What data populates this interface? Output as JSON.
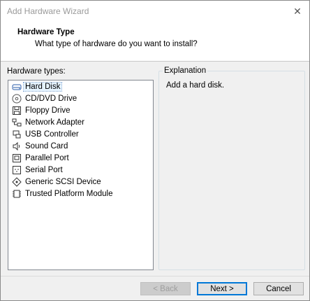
{
  "window": {
    "title": "Add Hardware Wizard",
    "close_glyph": "✕"
  },
  "header": {
    "title": "Hardware Type",
    "subtitle": "What type of hardware do you want to install?"
  },
  "hardware_list": {
    "label": "Hardware types:",
    "selected": "Hard Disk",
    "items": [
      {
        "label": "Hard Disk",
        "icon": "hard-disk-icon"
      },
      {
        "label": "CD/DVD Drive",
        "icon": "cd-dvd-icon"
      },
      {
        "label": "Floppy Drive",
        "icon": "floppy-icon"
      },
      {
        "label": "Network Adapter",
        "icon": "network-adapter-icon"
      },
      {
        "label": "USB Controller",
        "icon": "usb-icon"
      },
      {
        "label": "Sound Card",
        "icon": "speaker-icon"
      },
      {
        "label": "Parallel Port",
        "icon": "parallel-port-icon"
      },
      {
        "label": "Serial Port",
        "icon": "serial-port-icon"
      },
      {
        "label": "Generic SCSI Device",
        "icon": "scsi-icon"
      },
      {
        "label": "Trusted Platform Module",
        "icon": "tpm-icon"
      }
    ]
  },
  "explanation": {
    "legend": "Explanation",
    "text": "Add a hard disk."
  },
  "buttons": {
    "back": "< Back",
    "next": "Next >",
    "cancel": "Cancel"
  },
  "colors": {
    "selection_bg": "#e5f3ff",
    "default_button_border": "#0078d7"
  }
}
